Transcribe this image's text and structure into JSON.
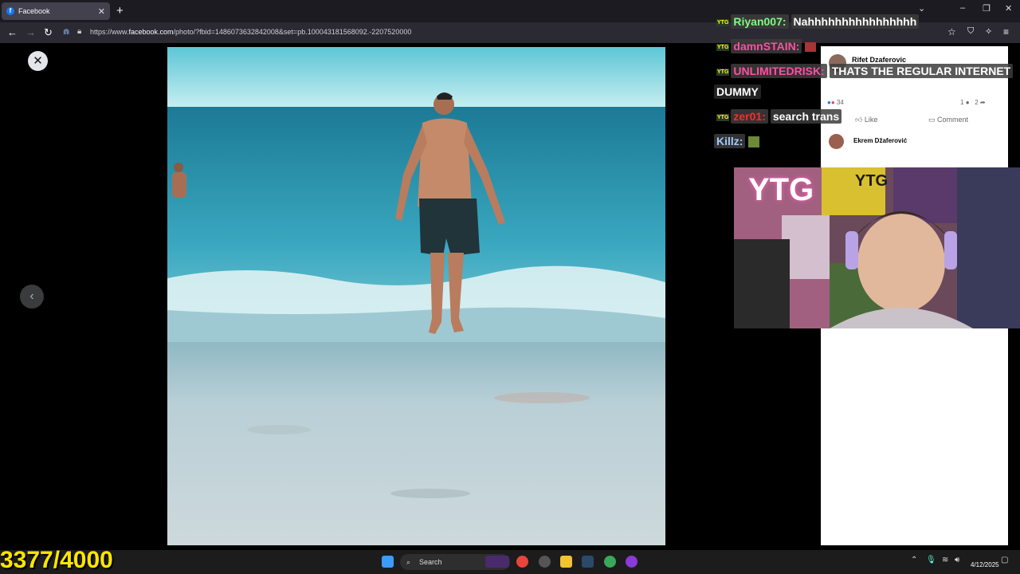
{
  "browser": {
    "tab_title": "Facebook",
    "tab_icon": "f",
    "url_prefix": "https://www.",
    "url_domain": "facebook.com",
    "url_rest": "/photo/?fbid=1486073632842008&set=pb.100043181568092.-2207520000"
  },
  "post": {
    "author": "Rifet Dzaferovic",
    "reaction_count": "34",
    "comment_count": "1",
    "share_count": "2",
    "like_label": "Like",
    "comment_label": "Comment",
    "commenter": "Ekrem Džaferović"
  },
  "chat": [
    {
      "user": "Riyan007:",
      "message": "Nahhhhhhhhhhhhhhhh",
      "user_color": "#7fff7f"
    },
    {
      "user": "damnSTAIN:",
      "message": "",
      "user_color": "#ff4fa3"
    },
    {
      "user": "UNLIMITEDRISK:",
      "message": "THATS THE REGULAR INTERNET",
      "user_color": "#ff4fa3"
    },
    {
      "user": "",
      "message": "DUMMY",
      "user_color": "#ffffff"
    },
    {
      "user": "zer01:",
      "message": "search trans",
      "user_color": "#ff2a2a"
    },
    {
      "user": "Killz:",
      "message": "",
      "user_color": "#a0c8ff"
    }
  ],
  "badge_label": "YTG",
  "webcam": {
    "sign": "YTG",
    "banner": "YTG"
  },
  "counter": "3377/4000",
  "taskbar": {
    "search_label": "Search",
    "date": "4/12/2025"
  },
  "colors": {
    "facebook_blue": "#1877f2",
    "counter_yellow": "#ffe600"
  }
}
